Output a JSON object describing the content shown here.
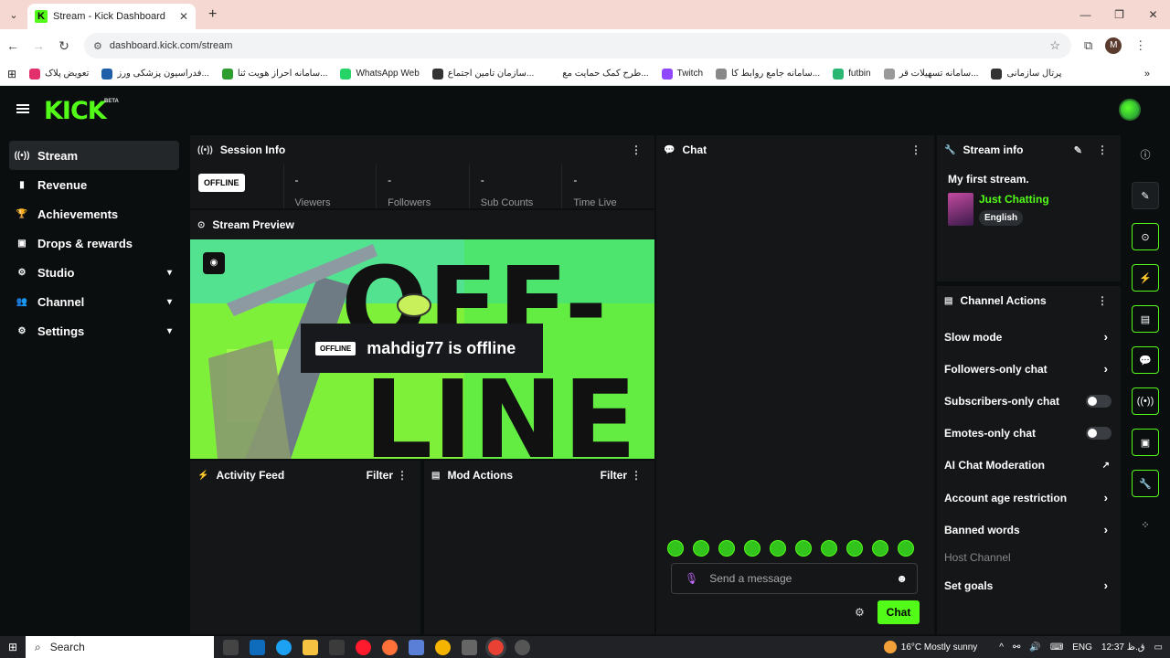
{
  "browser": {
    "tab_title": "Stream - Kick Dashboard",
    "url": "dashboard.kick.com/stream",
    "profile_initial": "M",
    "bookmarks": [
      {
        "label": "تعویض پلاک",
        "color": "#e1306c"
      },
      {
        "label": "فدراسیون پزشکی ورز...",
        "color": "#1f5fa8"
      },
      {
        "label": "سامانه احراز هویت ثنا...",
        "color": "#2e9e2e"
      },
      {
        "label": "WhatsApp Web",
        "color": "#25d366"
      },
      {
        "label": "سازمان تامین اجتماع...",
        "color": "#333333"
      },
      {
        "label": "طرح کمک حمایت مع...",
        "color": "#ffffff"
      },
      {
        "label": "Twitch",
        "color": "#9146ff"
      },
      {
        "label": "سامانه جامع روابط کا...",
        "color": "#888888"
      },
      {
        "label": "futbin",
        "color": "#2ab673"
      },
      {
        "label": "سامانه تسهیلات قر...",
        "color": "#999999"
      },
      {
        "label": "پرتال سازمانی",
        "color": "#333333"
      }
    ]
  },
  "app": {
    "logo": "KICK",
    "beta": "BETA",
    "sidebar": [
      {
        "label": "Stream",
        "icon": "broadcast-icon",
        "glyph": "((•))",
        "active": true,
        "chevron": false
      },
      {
        "label": "Revenue",
        "icon": "chart-icon",
        "glyph": "▮",
        "active": false,
        "chevron": false
      },
      {
        "label": "Achievements",
        "icon": "trophy-icon",
        "glyph": "🏆",
        "active": false,
        "chevron": false
      },
      {
        "label": "Drops & rewards",
        "icon": "gift-icon",
        "glyph": "▣",
        "active": false,
        "chevron": false
      },
      {
        "label": "Studio",
        "icon": "gear-icon",
        "glyph": "⚙",
        "active": false,
        "chevron": true
      },
      {
        "label": "Channel",
        "icon": "users-icon",
        "glyph": "👥",
        "active": false,
        "chevron": true
      },
      {
        "label": "Settings",
        "icon": "gear-icon",
        "glyph": "⚙",
        "active": false,
        "chevron": true
      }
    ],
    "session": {
      "title": "Session Info",
      "status": "OFFLINE",
      "stats": [
        {
          "value": "-",
          "label": "Viewers"
        },
        {
          "value": "-",
          "label": "Followers"
        },
        {
          "value": "-",
          "label": "Sub Counts"
        },
        {
          "value": "-",
          "label": "Time Live"
        }
      ]
    },
    "preview": {
      "title": "Stream Preview",
      "badge": "OFFLINE",
      "message": "mahdig77 is offline",
      "banner_text": "OFF-LINE"
    },
    "activity": {
      "title": "Activity Feed",
      "filter": "Filter"
    },
    "mod": {
      "title": "Mod Actions",
      "filter": "Filter"
    },
    "chat": {
      "title": "Chat",
      "placeholder": "Send a message",
      "send": "Chat"
    },
    "stream_info": {
      "title": "Stream info",
      "stream_title": "My first stream.",
      "category": "Just Chatting",
      "language": "English"
    },
    "channel_actions": {
      "title": "Channel Actions",
      "items": [
        {
          "label": "Slow mode",
          "type": "arrow"
        },
        {
          "label": "Followers-only chat",
          "type": "arrow"
        },
        {
          "label": "Subscribers-only chat",
          "type": "toggle"
        },
        {
          "label": "Emotes-only chat",
          "type": "toggle"
        },
        {
          "label": "AI Chat Moderation",
          "type": "external"
        },
        {
          "label": "Account age restriction",
          "type": "arrow"
        },
        {
          "label": "Banned words",
          "type": "arrow"
        },
        {
          "label": "Host Channel",
          "type": "disabled"
        },
        {
          "label": "Set goals",
          "type": "arrow"
        }
      ]
    }
  },
  "taskbar": {
    "search": "Search",
    "weather": "16°C  Mostly sunny",
    "lang": "ENG",
    "time": "12:37 ق.ظ"
  },
  "colors": {
    "accent": "#53fc18",
    "bg": "#0b0e0f",
    "panel": "#141618"
  }
}
